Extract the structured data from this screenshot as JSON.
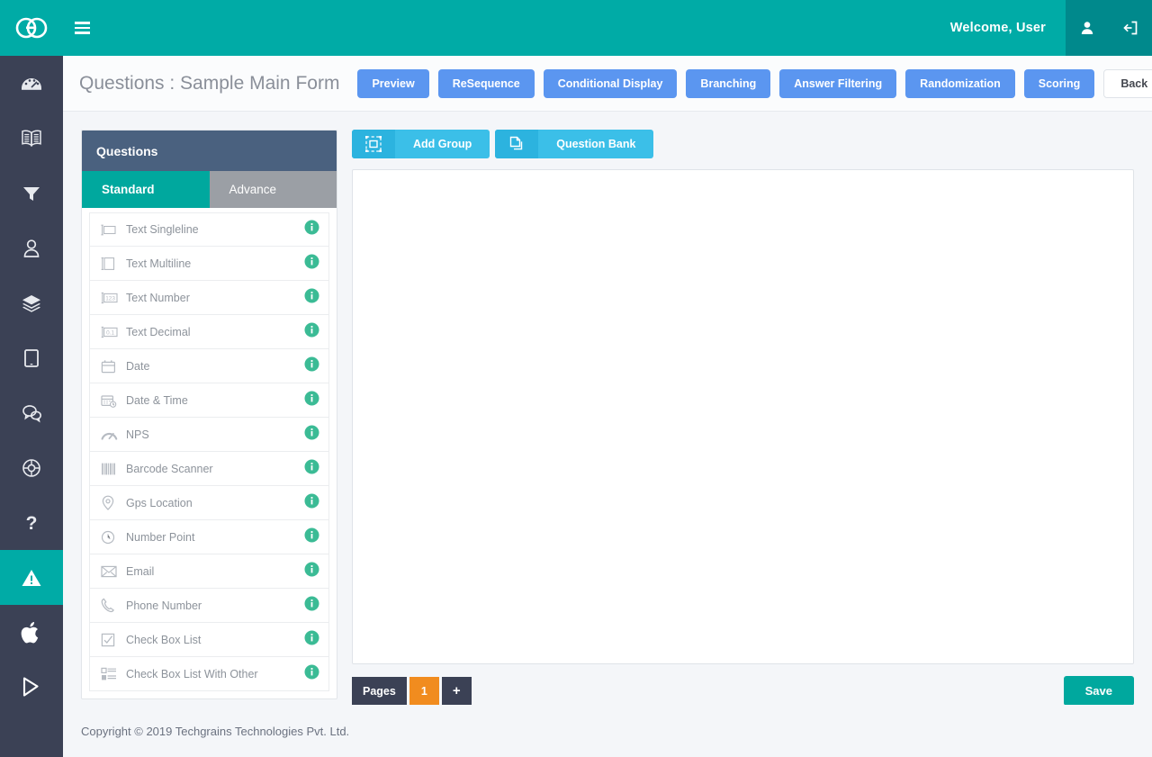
{
  "topbar": {
    "logo_text": "GO",
    "logo_icon": "go-logo-icon",
    "menu_icon": "hamburger-menu-icon",
    "welcome": "Welcome, User",
    "user_icon": "user-icon",
    "logout_icon": "logout-icon",
    "bg_color": "#00aba6",
    "right_bg_color": "#00898c"
  },
  "leftnav": {
    "bg_color": "#3b4155",
    "active_color": "#00aba6",
    "items": [
      {
        "name": "dashboard",
        "icon": "speedometer-icon",
        "active": false
      },
      {
        "name": "library",
        "icon": "book-icon",
        "active": false
      },
      {
        "name": "filter",
        "icon": "funnel-icon",
        "active": false
      },
      {
        "name": "users",
        "icon": "user-icon",
        "active": false
      },
      {
        "name": "layers",
        "icon": "layers-icon",
        "active": false
      },
      {
        "name": "devices",
        "icon": "tablet-icon",
        "active": false
      },
      {
        "name": "messages",
        "icon": "chat-bubbles-icon",
        "active": false
      },
      {
        "name": "support",
        "icon": "lifebuoy-icon",
        "active": false
      },
      {
        "name": "help",
        "icon": "question-mark-icon",
        "active": false
      },
      {
        "name": "alerts",
        "icon": "warning-triangle-icon",
        "active": true
      },
      {
        "name": "apple-app",
        "icon": "apple-icon",
        "active": false
      },
      {
        "name": "play-store-app",
        "icon": "google-play-icon",
        "active": false
      }
    ]
  },
  "header": {
    "title": "Questions : Sample Main Form",
    "buttons": [
      {
        "label": "Preview",
        "style": "blue"
      },
      {
        "label": "ReSequence",
        "style": "blue"
      },
      {
        "label": "Conditional Display",
        "style": "blue"
      },
      {
        "label": "Branching",
        "style": "blue"
      },
      {
        "label": "Answer Filtering",
        "style": "blue"
      },
      {
        "label": "Randomization",
        "style": "blue"
      },
      {
        "label": "Scoring",
        "style": "blue"
      }
    ],
    "back_label": "Back",
    "blue_color": "#5b96f0"
  },
  "questions_panel": {
    "heading": "Questions",
    "heading_bg": "#4a617f",
    "tabs": [
      {
        "label": "Standard",
        "active": true
      },
      {
        "label": "Advance",
        "active": false
      }
    ],
    "active_tab_color": "#00a89e",
    "inactive_tab_color": "#9b9fa5",
    "info_icon_color": "#3bbb95",
    "items": [
      {
        "label": "Text Singleline",
        "icon": "text-singleline-icon",
        "info_icon": "info-icon"
      },
      {
        "label": "Text Multiline",
        "icon": "text-multiline-icon",
        "info_icon": "info-icon"
      },
      {
        "label": "Text Number",
        "icon": "text-number-icon",
        "info_icon": "info-icon"
      },
      {
        "label": "Text Decimal",
        "icon": "text-decimal-icon",
        "info_icon": "info-icon"
      },
      {
        "label": "Date",
        "icon": "calendar-icon",
        "info_icon": "info-icon"
      },
      {
        "label": "Date & Time",
        "icon": "calendar-clock-icon",
        "info_icon": "info-icon"
      },
      {
        "label": "NPS",
        "icon": "gauge-icon",
        "info_icon": "info-icon"
      },
      {
        "label": "Barcode Scanner",
        "icon": "barcode-icon",
        "info_icon": "info-icon"
      },
      {
        "label": "Gps Location",
        "icon": "map-pin-icon",
        "info_icon": "info-icon"
      },
      {
        "label": "Number Point",
        "icon": "clock-dial-icon",
        "info_icon": "info-icon"
      },
      {
        "label": "Email",
        "icon": "envelope-icon",
        "info_icon": "info-icon"
      },
      {
        "label": "Phone Number",
        "icon": "phone-icon",
        "info_icon": "info-icon"
      },
      {
        "label": "Check Box List",
        "icon": "checkbox-icon",
        "info_icon": "info-icon"
      },
      {
        "label": "Check Box List With Other",
        "icon": "checkbox-list-icon",
        "info_icon": "info-icon"
      }
    ]
  },
  "toolbar": {
    "add_group_label": "Add Group",
    "add_group_icon": "group-frame-icon",
    "question_bank_label": "Question Bank",
    "question_bank_icon": "copy-pages-icon",
    "button_color": "#3bbfe8"
  },
  "canvas_footer": {
    "pages_label": "Pages",
    "page_numbers": [
      "1"
    ],
    "current_page": "1",
    "add_page_label": "+",
    "save_label": "Save",
    "page_active_color": "#f18c1f",
    "save_color": "#00a89e"
  },
  "footer": {
    "copyright": "Copyright © 2019 Techgrains Technologies Pvt. Ltd."
  }
}
